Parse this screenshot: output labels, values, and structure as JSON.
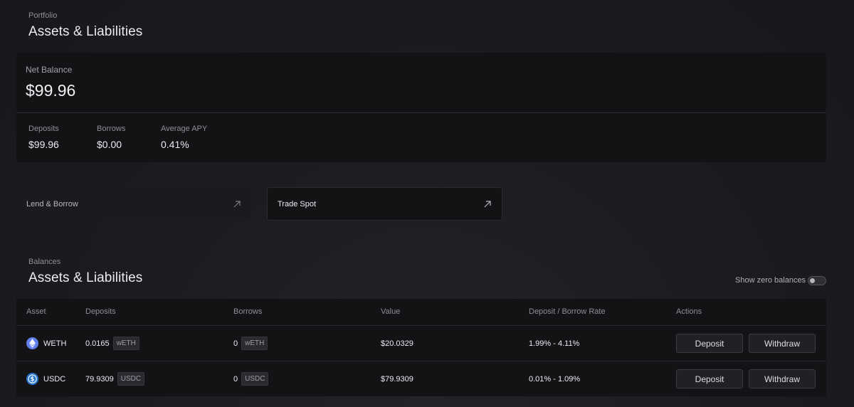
{
  "header": {
    "eyebrow": "Portfolio",
    "title": "Assets & Liabilities"
  },
  "net_balance": {
    "label": "Net Balance",
    "value": "$99.96",
    "stats": [
      {
        "label": "Deposits",
        "value": "$99.96"
      },
      {
        "label": "Borrows",
        "value": "$0.00"
      },
      {
        "label": "Average APY",
        "value": "0.41%"
      }
    ]
  },
  "links": [
    {
      "label": "Lend & Borrow",
      "icon": "arrow-up-right-icon"
    },
    {
      "label": "Trade Spot",
      "icon": "arrow-up-right-icon"
    }
  ],
  "balances": {
    "eyebrow": "Balances",
    "title": "Assets & Liabilities",
    "toggle_label": "Show zero balances",
    "show_zero_balances": false,
    "columns": [
      "Asset",
      "Deposits",
      "Borrows",
      "Value",
      "Deposit / Borrow Rate",
      "Actions"
    ],
    "rows": [
      {
        "asset": "WETH",
        "icon": "ethereum-icon",
        "deposits": "0.0165",
        "deposit_unit": "wETH",
        "borrows": "0",
        "borrow_unit": "wETH",
        "value": "$20.0329",
        "rate": "1.99% - 4.11%",
        "deposit_button": "Deposit",
        "withdraw_button": "Withdraw"
      },
      {
        "asset": "USDC",
        "icon": "usdc-icon",
        "deposits": "79.9309",
        "deposit_unit": "USDC",
        "borrows": "0",
        "borrow_unit": "USDC",
        "value": "$79.9309",
        "rate": "0.01% - 1.09%",
        "deposit_button": "Deposit",
        "withdraw_button": "Withdraw"
      }
    ]
  },
  "colors": {
    "eth": "#627eea",
    "usdc": "#2775ca",
    "background": "#1b1b20",
    "card": "#131316"
  }
}
